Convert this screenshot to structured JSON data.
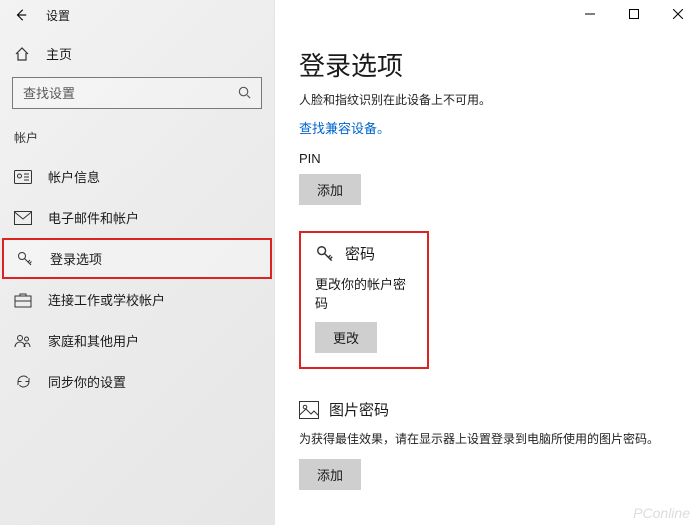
{
  "window": {
    "title": "设置"
  },
  "sidebar": {
    "home": "主页",
    "search_placeholder": "查找设置",
    "section": "帐户",
    "items": [
      {
        "label": "帐户信息"
      },
      {
        "label": "电子邮件和帐户"
      },
      {
        "label": "登录选项"
      },
      {
        "label": "连接工作或学校帐户"
      },
      {
        "label": "家庭和其他用户"
      },
      {
        "label": "同步你的设置"
      }
    ]
  },
  "main": {
    "heading": "登录选项",
    "subtext": "人脸和指纹识别在此设备上不可用。",
    "link": "查找兼容设备。",
    "pin": {
      "label": "PIN",
      "button": "添加"
    },
    "password": {
      "title": "密码",
      "desc": "更改你的帐户密码",
      "button": "更改"
    },
    "picture": {
      "title": "图片密码",
      "desc": "为获得最佳效果，请在显示器上设置登录到电脑所使用的图片密码。",
      "button": "添加"
    }
  },
  "watermark": "PConline"
}
